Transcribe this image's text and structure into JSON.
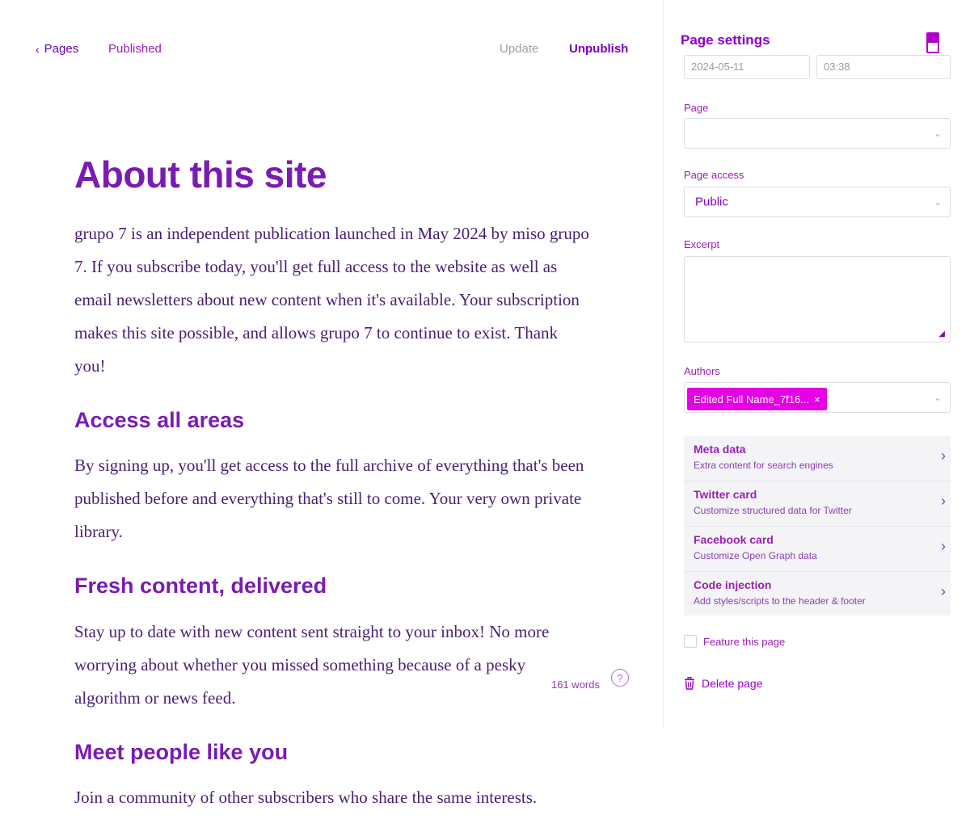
{
  "header": {
    "back_label": "Pages",
    "status": "Published",
    "update_label": "Update",
    "unpublish_label": "Unpublish"
  },
  "post": {
    "title": "About this site",
    "intro": "grupo 7 is an independent publication launched in May 2024 by miso grupo 7. If you subscribe today, you'll get full access to the website as well as email newsletters about new content when it's available. Your subscription makes this site possible, and allows grupo 7 to continue to exist. Thank you!",
    "section1_heading": "Access all areas",
    "section1_body": "By signing up, you'll get access to the full archive of everything that's been published before and everything that's still to come. Your very own private library.",
    "section2_heading": "Fresh content, delivered",
    "section2_body": "Stay up to date with new content sent straight to your inbox! No more worrying about whether you missed something because of a pesky algorithm or news feed.",
    "section3_heading": "Meet people like you",
    "section3_body": "Join a community of other subscribers who share the same interests."
  },
  "footer": {
    "word_count": "161 words",
    "help_icon": "?"
  },
  "sidebar": {
    "title": "Page settings",
    "date_value": "2024-05-11",
    "time_value": "03:38",
    "page_label": "Page",
    "page_access_label": "Page access",
    "page_access_value": "Public",
    "excerpt_label": "Excerpt",
    "authors_label": "Authors",
    "author_chip": "Edited Full Name_7f16...",
    "settings_items": [
      {
        "title": "Meta data",
        "desc": "Extra content for search engines"
      },
      {
        "title": "Twitter card",
        "desc": "Customize structured data for Twitter"
      },
      {
        "title": "Facebook card",
        "desc": "Customize Open Graph data"
      },
      {
        "title": "Code injection",
        "desc": "Add styles/scripts to the header & footer"
      }
    ],
    "feature_label": "Feature this page",
    "delete_label": "Delete page"
  },
  "colors": {
    "accent": "#8a00c8",
    "text_body": "#4a1f73",
    "chip_bg": "#e600e6"
  }
}
